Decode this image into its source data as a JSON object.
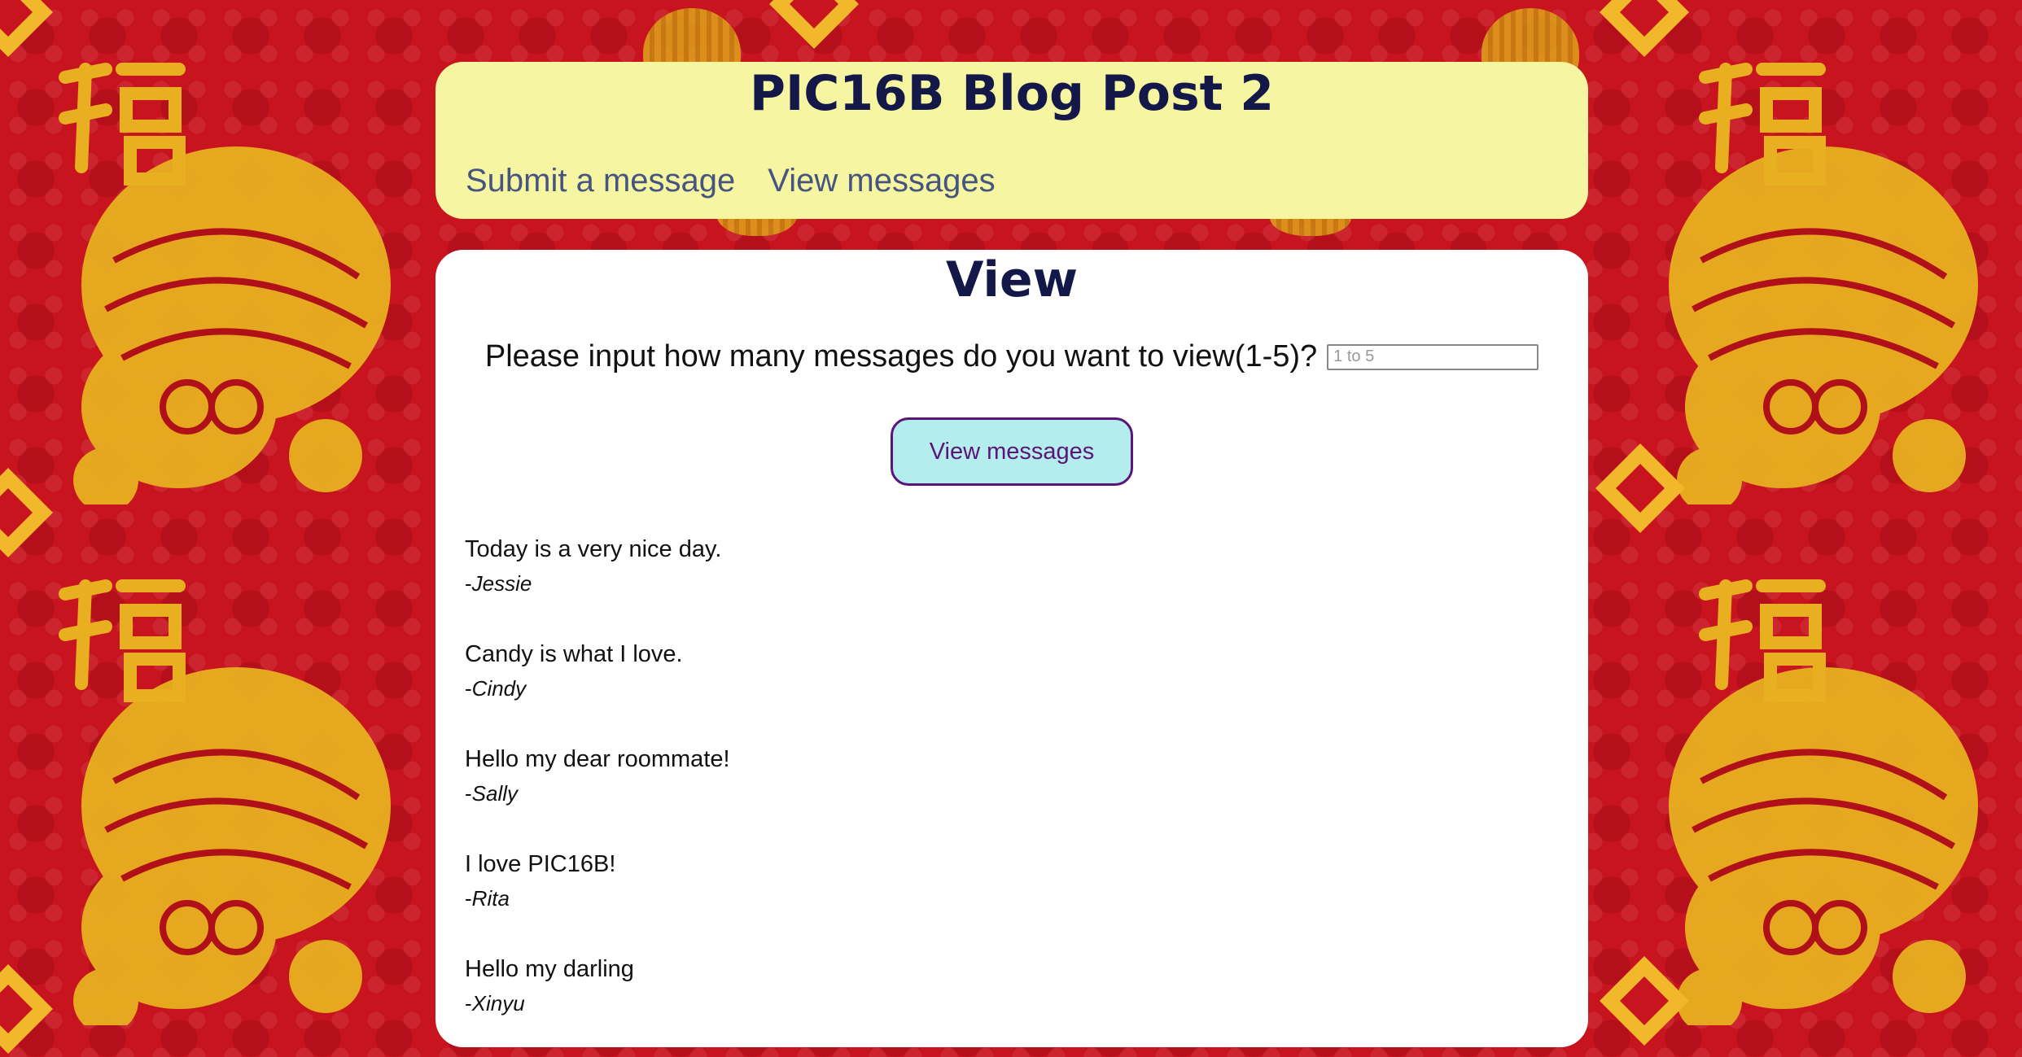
{
  "header": {
    "title": "PIC16B Blog Post 2",
    "nav": [
      {
        "label": "Submit a message"
      },
      {
        "label": "View messages"
      }
    ]
  },
  "view": {
    "heading": "View",
    "prompt_label": "Please input how many messages do you want to view(1-5)?",
    "count_input": {
      "value": "",
      "placeholder": "1 to 5"
    },
    "submit_label": "View messages"
  },
  "messages": [
    {
      "text": "Today is a very nice day.",
      "dash": "-",
      "author": "Jessie"
    },
    {
      "text": "Candy is what I love.",
      "dash": "-",
      "author": "Cindy"
    },
    {
      "text": "Hello my dear roommate!",
      "dash": "-",
      "author": "Sally"
    },
    {
      "text": "I love PIC16B!",
      "dash": "-",
      "author": "Rita"
    },
    {
      "text": "Hello my darling",
      "dash": "-",
      "author": "Xinyu"
    }
  ],
  "colors": {
    "background": "#c8141f",
    "gold": "#e8b020",
    "header_bg": "#f6f5a2",
    "title_color": "#141848",
    "nav_link": "#455580",
    "button_bg": "#b4eded",
    "button_border": "#5b1478"
  },
  "background_icons": [
    "tiger-papercut-icon",
    "fu-character-icon",
    "lantern-icon",
    "ornament-diamond-icon"
  ]
}
